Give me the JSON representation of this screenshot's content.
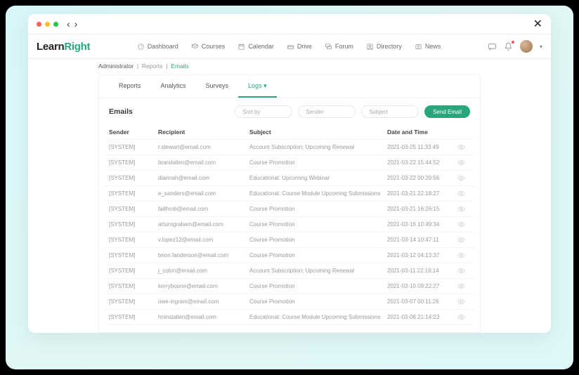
{
  "logo": {
    "part1": "Learn",
    "part2": "Right"
  },
  "mainnav": [
    {
      "label": "Dashboard",
      "icon": "dashboard"
    },
    {
      "label": "Courses",
      "icon": "courses"
    },
    {
      "label": "Calendar",
      "icon": "calendar"
    },
    {
      "label": "Drive",
      "icon": "drive"
    },
    {
      "label": "Forum",
      "icon": "forum"
    },
    {
      "label": "Directory",
      "icon": "directory"
    },
    {
      "label": "News",
      "icon": "news"
    }
  ],
  "breadcrumb": {
    "root": "Administrator",
    "mid": "Reports",
    "current": "Emails"
  },
  "subtabs": [
    {
      "label": "Reports",
      "active": false
    },
    {
      "label": "Analytics",
      "active": false
    },
    {
      "label": "Surveys",
      "active": false
    },
    {
      "label": "Logs",
      "active": true
    }
  ],
  "section_title": "Emails",
  "filters": {
    "sort_placeholder": "Sort by",
    "sender_placeholder": "Sender",
    "subject_placeholder": "Subject"
  },
  "send_button": "Send Email",
  "table": {
    "headers": {
      "sender": "Sender",
      "recipient": "Recipient",
      "subject": "Subject",
      "datetime": "Date and Time"
    },
    "rows": [
      {
        "sender": "[SYSTEM]",
        "recipient": "r.stewart@email.com",
        "subject": "Account Subscription: Upcoming Renewal",
        "datetime": "2021-03-25 11:33:49"
      },
      {
        "sender": "[SYSTEM]",
        "recipient": "brandallen@email.com",
        "subject": "Course Promotion",
        "datetime": "2021-03-22 15:44:52"
      },
      {
        "sender": "[SYSTEM]",
        "recipient": "diannah@email.com",
        "subject": "Educational: Upcoming Webinar",
        "datetime": "2021-03-22 00:20:56"
      },
      {
        "sender": "[SYSTEM]",
        "recipient": "e_sanders@email.com",
        "subject": "Educational: Course Module Upcoming Submissions",
        "datetime": "2021-03-21 22:18:27"
      },
      {
        "sender": "[SYSTEM]",
        "recipient": "faithrob@email.com",
        "subject": "Course Promotion",
        "datetime": "2021-03-21 16:26:15"
      },
      {
        "sender": "[SYSTEM]",
        "recipient": "arturograham@email.com",
        "subject": "Course Promotion",
        "datetime": "2021-03-16 10:49:34"
      },
      {
        "sender": "[SYSTEM]",
        "recipient": "v.lopez12@email.com",
        "subject": "Course Promotion",
        "datetime": "2021-03-14 10:47:11"
      },
      {
        "sender": "[SYSTEM]",
        "recipient": "brion.fanderson@email.com",
        "subject": "Course Promotion",
        "datetime": "2021-03-12 04:13:37"
      },
      {
        "sender": "[SYSTEM]",
        "recipient": "j_colon@email.com",
        "subject": "Account Subscription: Upcoming Renewal",
        "datetime": "2021-03-11 22:19:14"
      },
      {
        "sender": "[SYSTEM]",
        "recipient": "kerryboone@email.com",
        "subject": "Course Promotion",
        "datetime": "2021-03-10 09:22:27"
      },
      {
        "sender": "[SYSTEM]",
        "recipient": "owe-ingram@email.com",
        "subject": "Course Promotion",
        "datetime": "2021-03-07 00:11:26"
      },
      {
        "sender": "[SYSTEM]",
        "recipient": "hninstallen@email.com",
        "subject": "Educational: Course Module Upcoming Submissions",
        "datetime": "2021-03-06 21:14:23"
      }
    ]
  }
}
